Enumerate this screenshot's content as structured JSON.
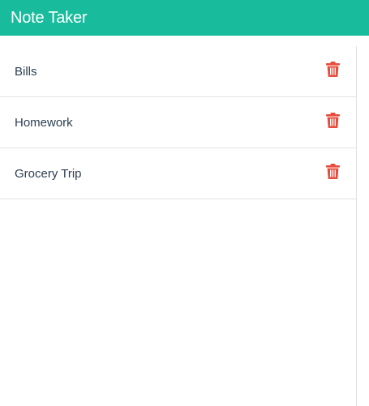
{
  "navbar": {
    "brand": "Note Taker"
  },
  "notes": {
    "items": [
      {
        "title": "Bills"
      },
      {
        "title": "Homework"
      },
      {
        "title": "Grocery Trip"
      }
    ],
    "delete_icon": "trash-icon"
  },
  "colors": {
    "navbar_bg": "#18bc9c",
    "delete_icon": "#e74c3c",
    "text": "#2c3e50",
    "divider": "#dee2e6"
  }
}
